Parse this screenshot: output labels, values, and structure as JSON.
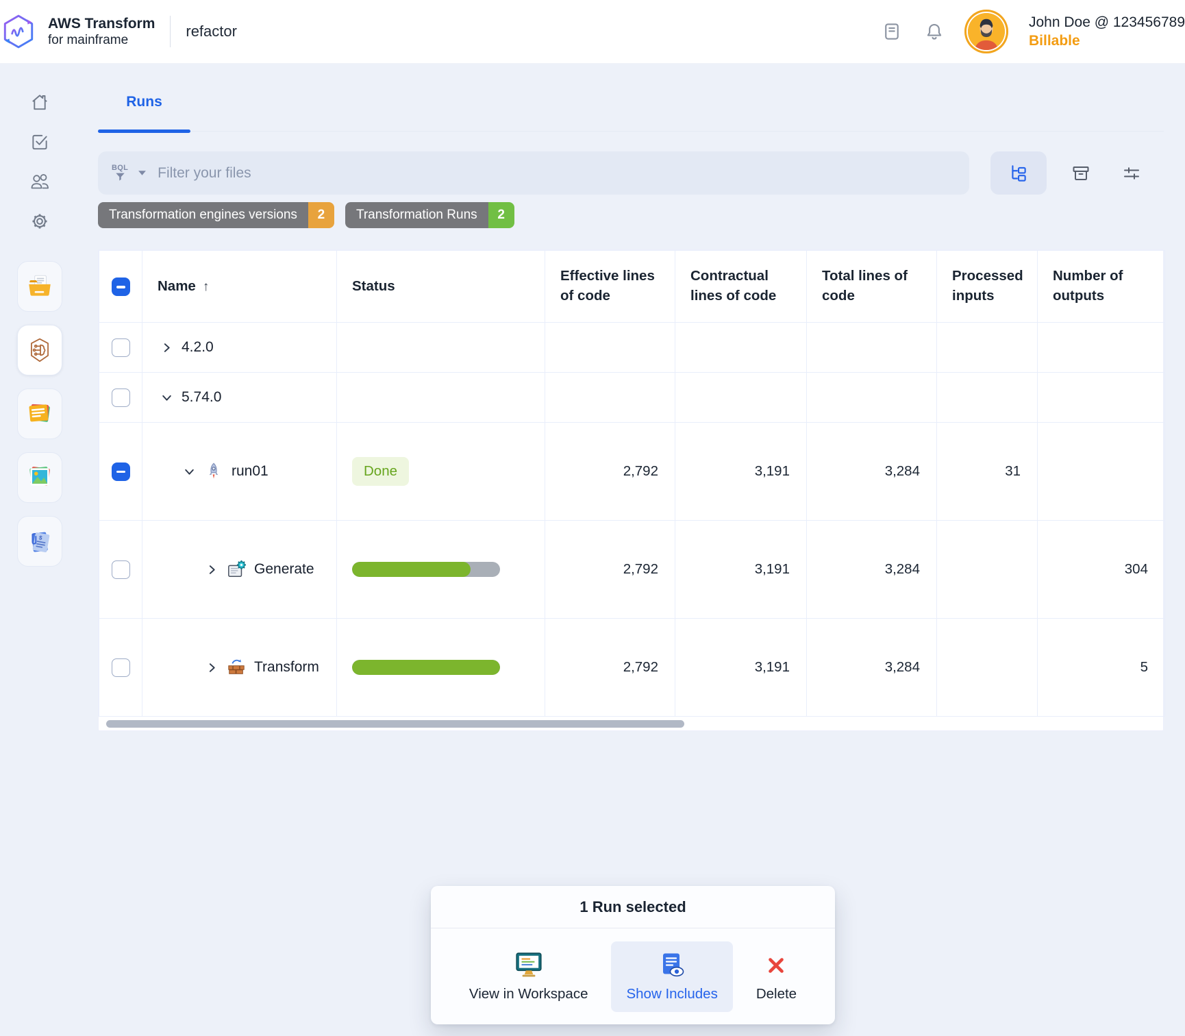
{
  "header": {
    "brand_line1": "AWS Transform",
    "brand_line2": "for mainframe",
    "app_name": "refactor",
    "user_name": "John Doe @ 123456789",
    "user_status": "Billable"
  },
  "sidebar": {
    "nav_icons": [
      "home-icon",
      "tasks-icon",
      "users-icon",
      "settings-icon"
    ],
    "project_icons": [
      "documents-folder-icon",
      "transform-engine-icon",
      "notes-icon",
      "images-icon",
      "billing-receipt-icon"
    ]
  },
  "tabs": {
    "runs_label": "Runs"
  },
  "filter": {
    "engine_label": "BQL",
    "placeholder": "Filter your files",
    "toolbar_icons": [
      "tree-view-icon",
      "archive-icon",
      "filter-settings-icon"
    ]
  },
  "tags": [
    {
      "label": "Transformation engines versions",
      "count": "2",
      "count_color": "#E8A33D"
    },
    {
      "label": "Transformation Runs",
      "count": "2",
      "count_color": "#71BF44"
    }
  ],
  "table": {
    "columns": [
      "Name",
      "Status",
      "Effective lines of code",
      "Contractual lines of code",
      "Total lines of code",
      "Processed inputs",
      "Number of outputs"
    ],
    "sort": {
      "column": "Name",
      "direction": "ascending",
      "arrow": "↑"
    },
    "rows": [
      {
        "name": "4.2.0",
        "type": "version",
        "expanded": false
      },
      {
        "name": "5.74.0",
        "type": "version",
        "expanded": true
      },
      {
        "name": "run01",
        "type": "run",
        "status": "Done",
        "effective_loc": "2,792",
        "contractual_loc": "3,191",
        "total_loc": "3,284",
        "processed_inputs": "31",
        "outputs": ""
      },
      {
        "name": "Generate",
        "type": "step",
        "progress_percent": 80,
        "effective_loc": "2,792",
        "contractual_loc": "3,191",
        "total_loc": "3,284",
        "processed_inputs": "",
        "outputs": "304"
      },
      {
        "name": "Transform",
        "type": "step",
        "progress_percent": 100,
        "effective_loc": "2,792",
        "contractual_loc": "3,191",
        "total_loc": "3,284",
        "processed_inputs": "",
        "outputs": "5"
      }
    ]
  },
  "selection_panel": {
    "title": "1 Run selected",
    "actions": [
      {
        "label": "View in Workspace"
      },
      {
        "label": "Show Includes"
      },
      {
        "label": "Delete"
      }
    ]
  },
  "colors": {
    "accent_blue": "#1F63E6",
    "progress_green": "#7CB52D",
    "progress_track_gray": "#A9AFB7",
    "done_badge_bg": "#EEF6DF",
    "done_badge_text": "#67A51E",
    "billable_orange": "#F39C12",
    "tag_gray": "#76777B",
    "page_bg": "#EDF1F9"
  }
}
